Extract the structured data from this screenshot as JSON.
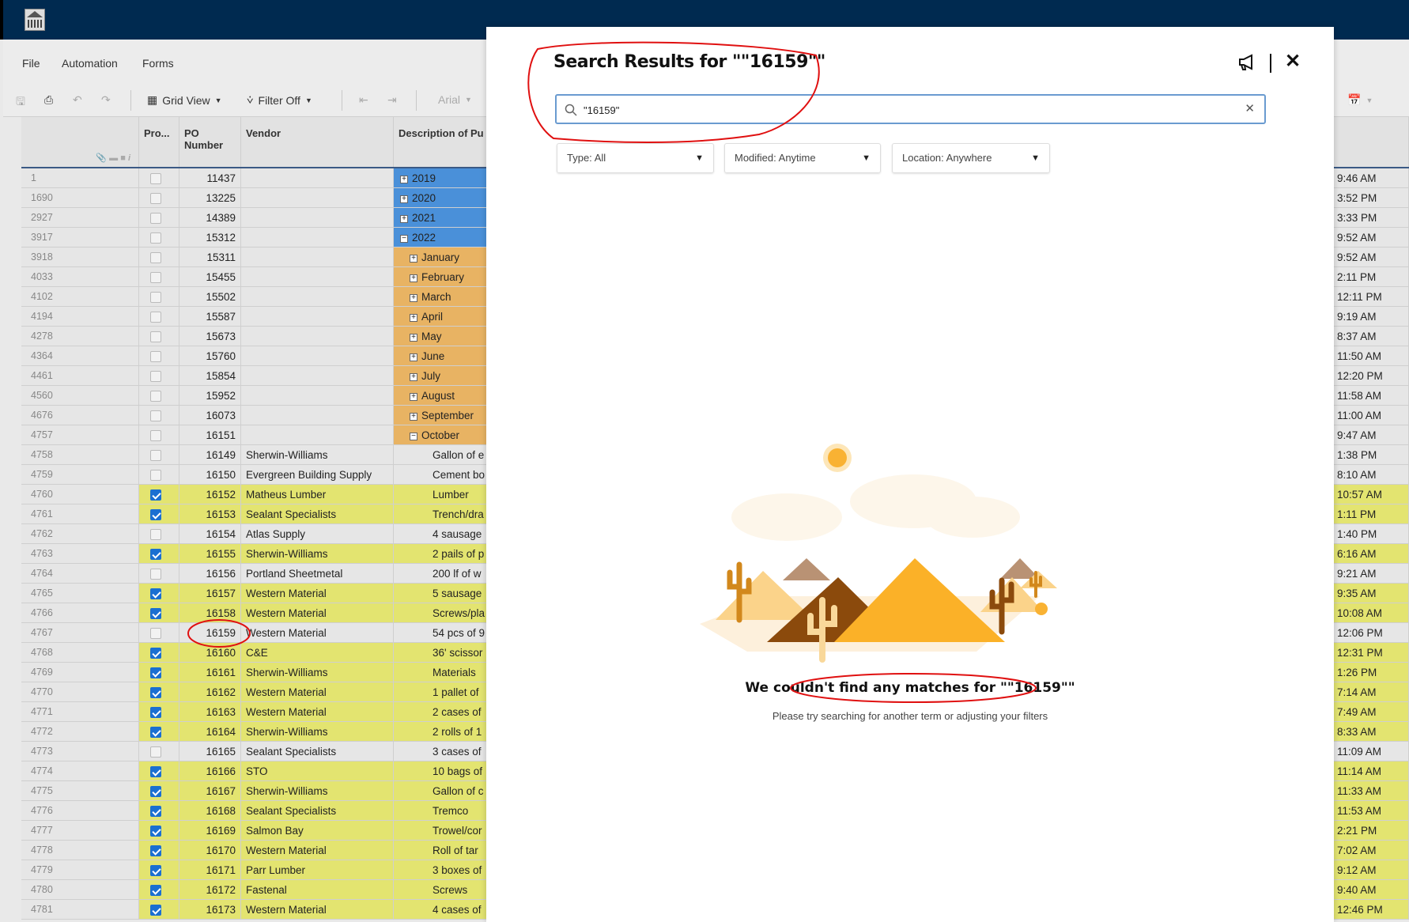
{
  "menu": {
    "items": [
      "File",
      "Automation",
      "Forms"
    ]
  },
  "toolbar": {
    "grid_view": "Grid View",
    "filter": "Filter Off",
    "font": "Arial"
  },
  "grid": {
    "headers": [
      "Pro...",
      "PO\nNumber",
      "Vendor",
      "Description of Pu"
    ],
    "colors": {
      "checked_row": "#e3e470",
      "group_year": "#4a90d9",
      "group_month": "#e8b363",
      "row": "#e6e6e6"
    },
    "rows": [
      {
        "n": "1",
        "po": "11437",
        "desc": "2019",
        "type": "year",
        "toggle": "+",
        "time": "9:46 AM"
      },
      {
        "n": "1690",
        "po": "13225",
        "desc": "2020",
        "type": "year",
        "toggle": "+",
        "time": "3:52 PM"
      },
      {
        "n": "2927",
        "po": "14389",
        "desc": "2021",
        "type": "year",
        "toggle": "+",
        "time": "3:33 PM"
      },
      {
        "n": "3917",
        "po": "15312",
        "desc": "2022",
        "type": "year",
        "toggle": "−",
        "time": "9:52 AM"
      },
      {
        "n": "3918",
        "po": "15311",
        "desc": "January",
        "type": "month",
        "toggle": "+",
        "time": "9:52 AM"
      },
      {
        "n": "4033",
        "po": "15455",
        "desc": "February",
        "type": "month",
        "toggle": "+",
        "time": "2:11 PM"
      },
      {
        "n": "4102",
        "po": "15502",
        "desc": "March",
        "type": "month",
        "toggle": "+",
        "time": "12:11 PM"
      },
      {
        "n": "4194",
        "po": "15587",
        "desc": "April",
        "type": "month",
        "toggle": "+",
        "time": "9:19 AM"
      },
      {
        "n": "4278",
        "po": "15673",
        "desc": "May",
        "type": "month",
        "toggle": "+",
        "time": "8:37 AM"
      },
      {
        "n": "4364",
        "po": "15760",
        "desc": "June",
        "type": "month",
        "toggle": "+",
        "time": "11:50 AM"
      },
      {
        "n": "4461",
        "po": "15854",
        "desc": "July",
        "type": "month",
        "toggle": "+",
        "time": "12:20 PM"
      },
      {
        "n": "4560",
        "po": "15952",
        "desc": "August",
        "type": "month",
        "toggle": "+",
        "time": "11:58 AM"
      },
      {
        "n": "4676",
        "po": "16073",
        "desc": "September",
        "type": "month",
        "toggle": "+",
        "time": "11:00 AM"
      },
      {
        "n": "4757",
        "po": "16151",
        "desc": "October",
        "type": "month",
        "toggle": "−",
        "time": "9:47 AM"
      },
      {
        "n": "4758",
        "po": "16149",
        "vendor": "Sherwin-Williams",
        "desc": "Gallon of e",
        "checked": false,
        "time": "1:38 PM"
      },
      {
        "n": "4759",
        "po": "16150",
        "vendor": "Evergreen Building Supply",
        "desc": "Cement bo",
        "checked": false,
        "time": "8:10 AM"
      },
      {
        "n": "4760",
        "po": "16152",
        "vendor": "Matheus Lumber",
        "desc": "Lumber",
        "checked": true,
        "time": "10:57 AM"
      },
      {
        "n": "4761",
        "po": "16153",
        "vendor": "Sealant Specialists",
        "desc": "Trench/dra",
        "checked": true,
        "time": "1:11 PM"
      },
      {
        "n": "4762",
        "po": "16154",
        "vendor": "Atlas Supply",
        "desc": "4 sausage",
        "checked": false,
        "time": "1:40 PM"
      },
      {
        "n": "4763",
        "po": "16155",
        "vendor": "Sherwin-Williams",
        "desc": "2 pails of p",
        "checked": true,
        "time": "6:16 AM"
      },
      {
        "n": "4764",
        "po": "16156",
        "vendor": "Portland Sheetmetal",
        "desc": "200 lf of w",
        "checked": false,
        "time": "9:21 AM"
      },
      {
        "n": "4765",
        "po": "16157",
        "vendor": "Western Material",
        "desc": "5 sausage",
        "checked": true,
        "time": "9:35 AM"
      },
      {
        "n": "4766",
        "po": "16158",
        "vendor": "Western Material",
        "desc": "Screws/pla",
        "checked": true,
        "time": "10:08 AM"
      },
      {
        "n": "4767",
        "po": "16159",
        "vendor": "Western Material",
        "desc": "54 pcs of 9",
        "checked": false,
        "time": "12:06 PM"
      },
      {
        "n": "4768",
        "po": "16160",
        "vendor": "C&E",
        "desc": "36' scissor",
        "checked": true,
        "time": "12:31 PM"
      },
      {
        "n": "4769",
        "po": "16161",
        "vendor": "Sherwin-Williams",
        "desc": "Materials",
        "checked": true,
        "time": "1:26 PM"
      },
      {
        "n": "4770",
        "po": "16162",
        "vendor": "Western Material",
        "desc": "1 pallet of",
        "checked": true,
        "time": "7:14 AM"
      },
      {
        "n": "4771",
        "po": "16163",
        "vendor": "Western Material",
        "desc": "2 cases of",
        "checked": true,
        "time": "7:49 AM"
      },
      {
        "n": "4772",
        "po": "16164",
        "vendor": "Sherwin-Williams",
        "desc": "2 rolls of 1",
        "checked": true,
        "time": "8:33 AM"
      },
      {
        "n": "4773",
        "po": "16165",
        "vendor": "Sealant Specialists",
        "desc": "3 cases of",
        "checked": false,
        "time": "11:09 AM"
      },
      {
        "n": "4774",
        "po": "16166",
        "vendor": "STO",
        "desc": "10 bags of",
        "checked": true,
        "time": "11:14 AM"
      },
      {
        "n": "4775",
        "po": "16167",
        "vendor": "Sherwin-Williams",
        "desc": "Gallon of c",
        "checked": true,
        "time": "11:33 AM"
      },
      {
        "n": "4776",
        "po": "16168",
        "vendor": "Sealant Specialists",
        "desc": "Tremco",
        "checked": true,
        "time": "11:53 AM"
      },
      {
        "n": "4777",
        "po": "16169",
        "vendor": "Salmon Bay",
        "desc": "Trowel/cor",
        "checked": true,
        "time": "2:21 PM"
      },
      {
        "n": "4778",
        "po": "16170",
        "vendor": "Western Material",
        "desc": "Roll of tar",
        "checked": true,
        "time": "7:02 AM"
      },
      {
        "n": "4779",
        "po": "16171",
        "vendor": "Parr Lumber",
        "desc": "3 boxes of",
        "checked": true,
        "time": "9:12 AM"
      },
      {
        "n": "4780",
        "po": "16172",
        "vendor": "Fastenal",
        "desc": "Screws",
        "checked": true,
        "time": "9:40 AM"
      },
      {
        "n": "4781",
        "po": "16173",
        "vendor": "Western Material",
        "desc": "4 cases of",
        "checked": true,
        "time": "12:46 PM"
      }
    ]
  },
  "modal": {
    "title": "Search Results for \"\"16159\"\"",
    "search_value": "\"16159\"",
    "filters": [
      "Type: All",
      "Modified: Anytime",
      "Location: Anywhere"
    ],
    "empty_title": "We couldn't find any matches for \"\"16159\"\"",
    "empty_subtitle": "Please try searching for another term or adjusting your filters",
    "icons": [
      "megaphone-icon",
      "close-icon",
      "search-icon",
      "clear-icon"
    ]
  }
}
